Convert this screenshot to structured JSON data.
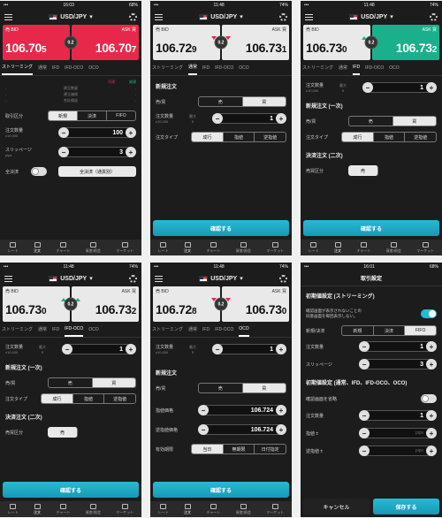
{
  "pair": "USD/JPY",
  "labels": {
    "bid": "売 BID",
    "ask": "ASK 買",
    "spread": "0.2"
  },
  "tabs": [
    "ストリーミング",
    "通常",
    "IFD",
    "IFD-OCO",
    "OCO"
  ],
  "tabbar": [
    "レート",
    "注文",
    "チャート",
    "資産/照会",
    "マーケット"
  ],
  "common": {
    "confirm": "確認する",
    "new_order": "新規注文",
    "sell_buy": "売/買",
    "sell": "売",
    "buy": "買",
    "qty": "注文数量",
    "unit": "x10,000",
    "max": "最大",
    "max_n": "5",
    "order_type": "注文タイプ",
    "market": "成行",
    "limit": "指値",
    "stop": "逆指値"
  },
  "phones": [
    {
      "time": "16:03",
      "battery": "68%",
      "bid": {
        "a": "106.70",
        "b": "5"
      },
      "ask": {
        "a": "106.70",
        "b": "7"
      },
      "pos": {
        "r1": "売建",
        "r2": "買建",
        "l1": "建玉数量",
        "l2": "建玉価格",
        "l3": "合計損益"
      },
      "settle_label": "取引区分",
      "settle_opts": [
        "新規",
        "決済",
        "FIFO"
      ],
      "qty_val": "100",
      "slip_label": "スリッページ",
      "slip_sub": "pips",
      "slip_val": "3",
      "allclose_label": "全決済",
      "allclose_btn": "全決済（通貨別）"
    },
    {
      "time": "11:48",
      "battery": "74%",
      "bid": {
        "a": "106.72",
        "b": "9"
      },
      "ask": {
        "a": "106.73",
        "b": "1"
      },
      "qty_val": "1"
    },
    {
      "time": "11:48",
      "battery": "74%",
      "bid": {
        "a": "106.73",
        "b": "0"
      },
      "ask": {
        "a": "106.73",
        "b": "2"
      },
      "qty_val": "1",
      "new1": "新規注文 (一次)",
      "settle2": "決済注文 (二次)",
      "settle_div": "売買区分"
    },
    {
      "time": "11:48",
      "battery": "74%",
      "bid": {
        "a": "106.73",
        "b": "0"
      },
      "ask": {
        "a": "106.73",
        "b": "2"
      },
      "qty_val": "1",
      "new1": "新規注文 (一次)",
      "settle2": "決済注文 (二次)",
      "settle_div": "売買区分"
    },
    {
      "time": "11:48",
      "battery": "74%",
      "bid": {
        "a": "106.72",
        "b": "8"
      },
      "ask": {
        "a": "106.73",
        "b": "0"
      },
      "qty_val": "1",
      "new_order2": "新規注文",
      "limit_price": "指値価格",
      "limit_val": "106.724",
      "stop_price": "逆指値価格",
      "stop_val": "106.724",
      "expiry": "有効期限",
      "expiry_opts": [
        "当日",
        "無期限",
        "日付指定"
      ]
    },
    {
      "time": "16:01",
      "battery": "68%",
      "title": "取引設定",
      "sec1": "初期値設定 (ストリーミング)",
      "confirm_line1": "確認画面が表示されないことの",
      "confirm_line2": "同意画面を毎回表示しない。",
      "new_settle": "新規/決済",
      "opts": [
        "新規",
        "決済",
        "FIFO"
      ],
      "qty": "注文数量",
      "qty_val": "1",
      "slip": "スリッページ",
      "slip_val": "3",
      "sec2": "初期値設定 (通常、IFD、IFD-OCO、OCO)",
      "skip": "確認画面を省略",
      "qty2": "注文数量",
      "qty2_val": "1",
      "limit": "指値 ±",
      "stop": "逆指値 ±",
      "pips": "pips",
      "cancel": "キャンセル",
      "save": "保存する"
    }
  ]
}
